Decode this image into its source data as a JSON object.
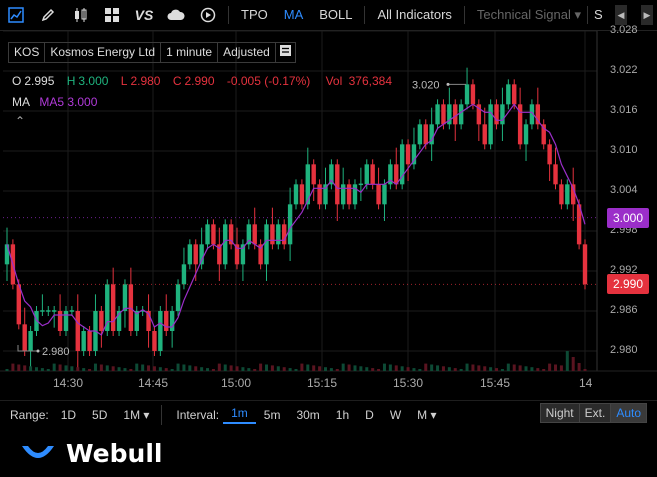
{
  "toolbar": {
    "tools": [
      "trend-line-icon",
      "pencil-icon",
      "candlestick-icon",
      "widgets-icon",
      "vs-compare-icon",
      "cloud-icon",
      "replay-icon"
    ],
    "vs_label": "VS",
    "indicators": [
      {
        "label": "TPO",
        "active": false
      },
      {
        "label": "MA",
        "active": true
      },
      {
        "label": "BOLL",
        "active": false
      }
    ],
    "all_indicators": "All Indicators",
    "technical_signal": "Technical Signal",
    "overflow": "S"
  },
  "info": {
    "ticker": "KOS",
    "company": "Kosmos Energy Ltd",
    "interval": "1 minute",
    "adjust": "Adjusted"
  },
  "ohlc": {
    "o_label": "O",
    "o": "2.995",
    "h_label": "H",
    "h": "3.000",
    "l_label": "L",
    "l": "2.980",
    "c_label": "C",
    "c": "2.990",
    "change": "-0.005 (-0.17%)",
    "vol_label": "Vol",
    "vol": "376,384"
  },
  "ma": {
    "label": "MA",
    "ma5": "MA5 3.000"
  },
  "collapse_glyph": "⌃",
  "price_axis": {
    "ticks": [
      "3.028",
      "3.022",
      "3.016",
      "3.010",
      "3.004",
      "2.998",
      "2.992",
      "2.986",
      "2.980"
    ],
    "tags": [
      {
        "label": "3.000",
        "value": 3.0,
        "color": "#9b2ec9"
      },
      {
        "label": "2.990",
        "value": 2.99,
        "color": "#e5323e"
      }
    ]
  },
  "annotations": {
    "high": "3.020",
    "low": "2.980"
  },
  "time_axis": [
    "14:30",
    "14:45",
    "15:00",
    "15:15",
    "15:30",
    "15:45",
    "14"
  ],
  "colors": {
    "up": "#1fb37e",
    "down": "#e5323e",
    "ma": "#9b2ec9",
    "accent": "#2e8cff"
  },
  "chart_data": {
    "type": "candlestick",
    "ylim": [
      2.977,
      3.028
    ],
    "closes": [
      2.996,
      2.99,
      2.984,
      2.98,
      2.983,
      2.986,
      2.986,
      2.986,
      2.986,
      2.983,
      2.986,
      2.986,
      2.98,
      2.983,
      2.98,
      2.986,
      2.983,
      2.99,
      2.983,
      2.986,
      2.99,
      2.983,
      2.986,
      2.986,
      2.983,
      2.98,
      2.986,
      2.983,
      2.986,
      2.99,
      2.993,
      2.996,
      2.993,
      2.996,
      2.999,
      2.996,
      2.993,
      2.999,
      2.996,
      2.993,
      2.996,
      2.999,
      2.996,
      2.993,
      2.999,
      2.996,
      2.999,
      2.996,
      3.002,
      3.005,
      3.002,
      3.008,
      3.005,
      3.002,
      3.005,
      3.008,
      3.002,
      3.005,
      3.002,
      3.005,
      3.005,
      3.008,
      3.005,
      3.002,
      3.005,
      3.008,
      3.005,
      3.011,
      3.008,
      3.011,
      3.014,
      3.011,
      3.014,
      3.017,
      3.014,
      3.017,
      3.014,
      3.017,
      3.02,
      3.017,
      3.014,
      3.011,
      3.017,
      3.014,
      3.017,
      3.02,
      3.017,
      3.011,
      3.014,
      3.017,
      3.014,
      3.011,
      3.008,
      3.005,
      3.002,
      3.005,
      3.002,
      2.996,
      2.99
    ]
  },
  "bottom": {
    "range_label": "Range:",
    "ranges": [
      {
        "label": "1D"
      },
      {
        "label": "5D"
      },
      {
        "label": "1M ▾"
      }
    ],
    "interval_label": "Interval:",
    "intervals": [
      {
        "label": "1m",
        "active": true
      },
      {
        "label": "5m"
      },
      {
        "label": "30m"
      },
      {
        "label": "1h"
      },
      {
        "label": "D"
      },
      {
        "label": "W"
      },
      {
        "label": "M ▾"
      }
    ],
    "session": [
      "Night",
      "Ext.",
      "Auto"
    ]
  },
  "brand": "Webull"
}
